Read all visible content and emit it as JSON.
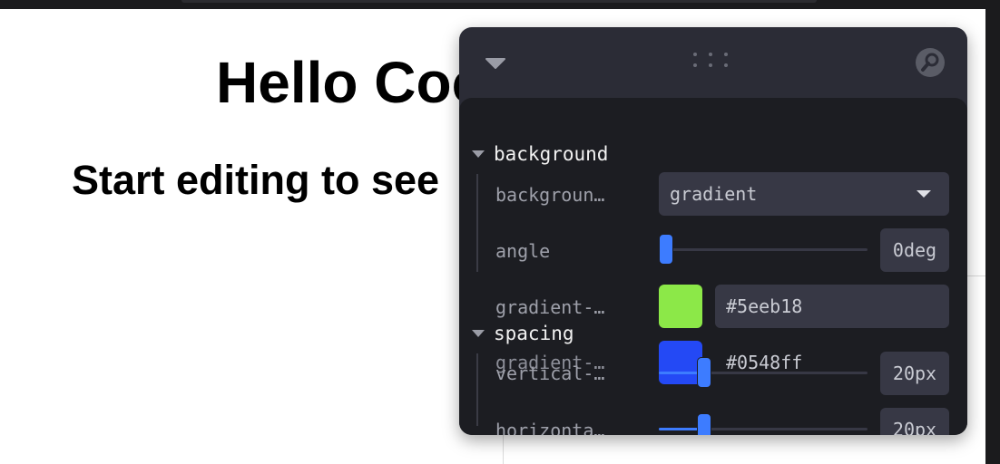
{
  "page": {
    "heading": "Hello Coc",
    "subheading": "Start editing to see"
  },
  "panel": {
    "folders": [
      {
        "title": "background",
        "rows": [
          {
            "label": "backgroun…",
            "type": "select",
            "value": "gradient"
          },
          {
            "label": "angle",
            "type": "slider",
            "value": "0deg",
            "fraction": 0.0
          },
          {
            "label": "gradient-…",
            "type": "color",
            "value": "#5eeb18",
            "swatch": "#8ce848"
          },
          {
            "label": "gradient-…",
            "type": "color",
            "value": "#0548ff",
            "swatch": "#2449f5"
          }
        ]
      },
      {
        "title": "spacing",
        "rows": [
          {
            "label": "vertical-…",
            "type": "slider",
            "value": "20px",
            "fraction": 0.2
          },
          {
            "label": "horizonta…",
            "type": "slider",
            "value": "20px",
            "fraction": 0.2
          }
        ]
      }
    ],
    "icons": {
      "collapse": "chevron-down-icon",
      "drag": "drag-handle-icon",
      "search": "search-icon"
    },
    "colors": {
      "accent": "#3d7cff",
      "panel_bg": "#1c1d22",
      "header_bg": "#2b2c36"
    }
  }
}
